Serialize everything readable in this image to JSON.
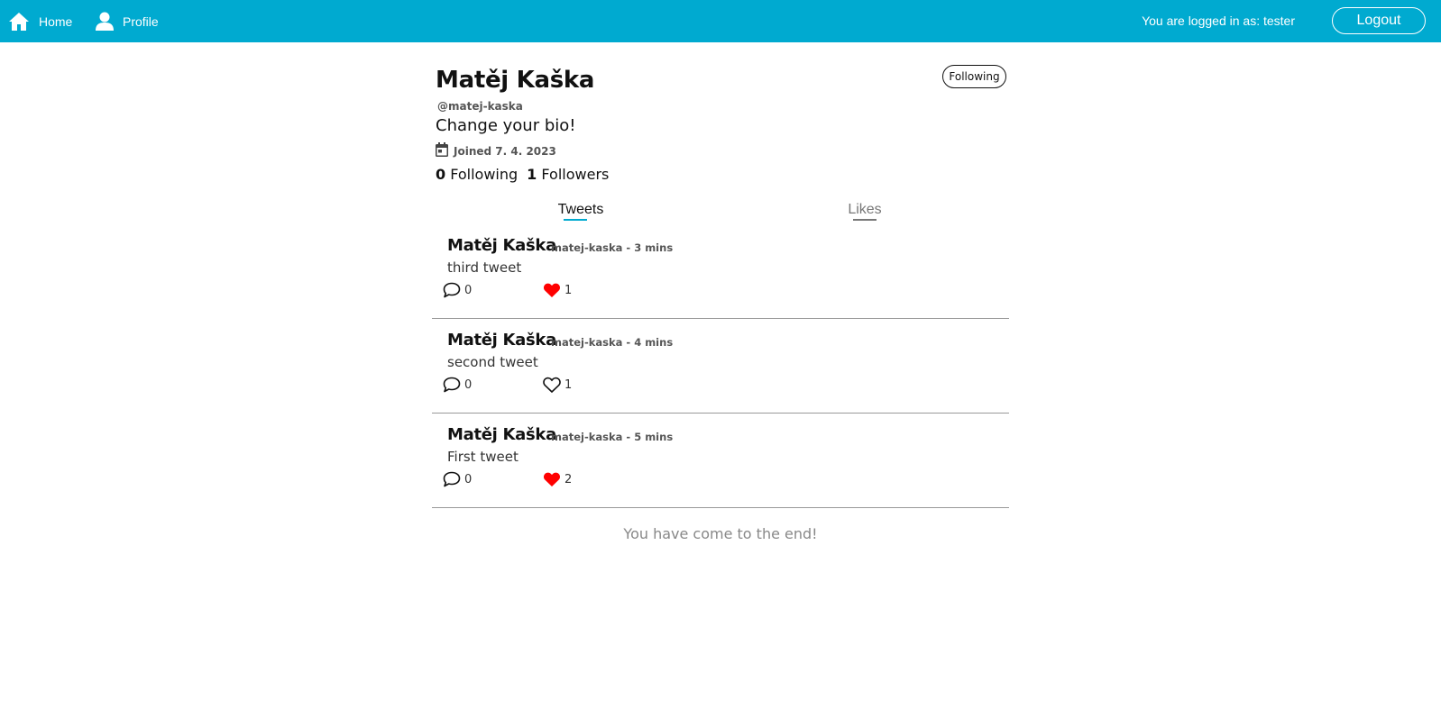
{
  "nav": {
    "home_label": "Home",
    "profile_label": "Profile",
    "logged_in_text": "You are logged in as: tester",
    "logout_label": "Logout",
    "bar_color": "#00aad0"
  },
  "profile": {
    "name": "Matěj Kaška",
    "handle": "@matej-kaska",
    "bio": "Change your bio!",
    "joined": "Joined 7. 4. 2023",
    "follow_button": "Following",
    "following_count": "0",
    "following_label": "Following",
    "followers_count": "1",
    "followers_label": "Followers"
  },
  "tabs": {
    "tweets": "Tweets",
    "likes": "Likes",
    "active": "Tweets"
  },
  "tweets": [
    {
      "author": "Matěj Kaška",
      "meta": "matej-kaska - 3 mins",
      "text": "third tweet",
      "comments": "0",
      "likes": "1",
      "liked": true
    },
    {
      "author": "Matěj Kaška",
      "meta": "matej-kaska - 4 mins",
      "text": "second tweet",
      "comments": "0",
      "likes": "1",
      "liked": false
    },
    {
      "author": "Matěj Kaška",
      "meta": "matej-kaska - 5 mins",
      "text": "First tweet",
      "comments": "0",
      "likes": "2",
      "liked": true
    }
  ],
  "end_message": "You have come to the end!",
  "icons": {
    "home": "home-icon",
    "profile": "user-icon",
    "calendar": "calendar-icon",
    "comment": "comment-icon",
    "like": "heart-icon"
  },
  "colors": {
    "liked_heart": "#ff0000",
    "accent": "#00aad0"
  }
}
